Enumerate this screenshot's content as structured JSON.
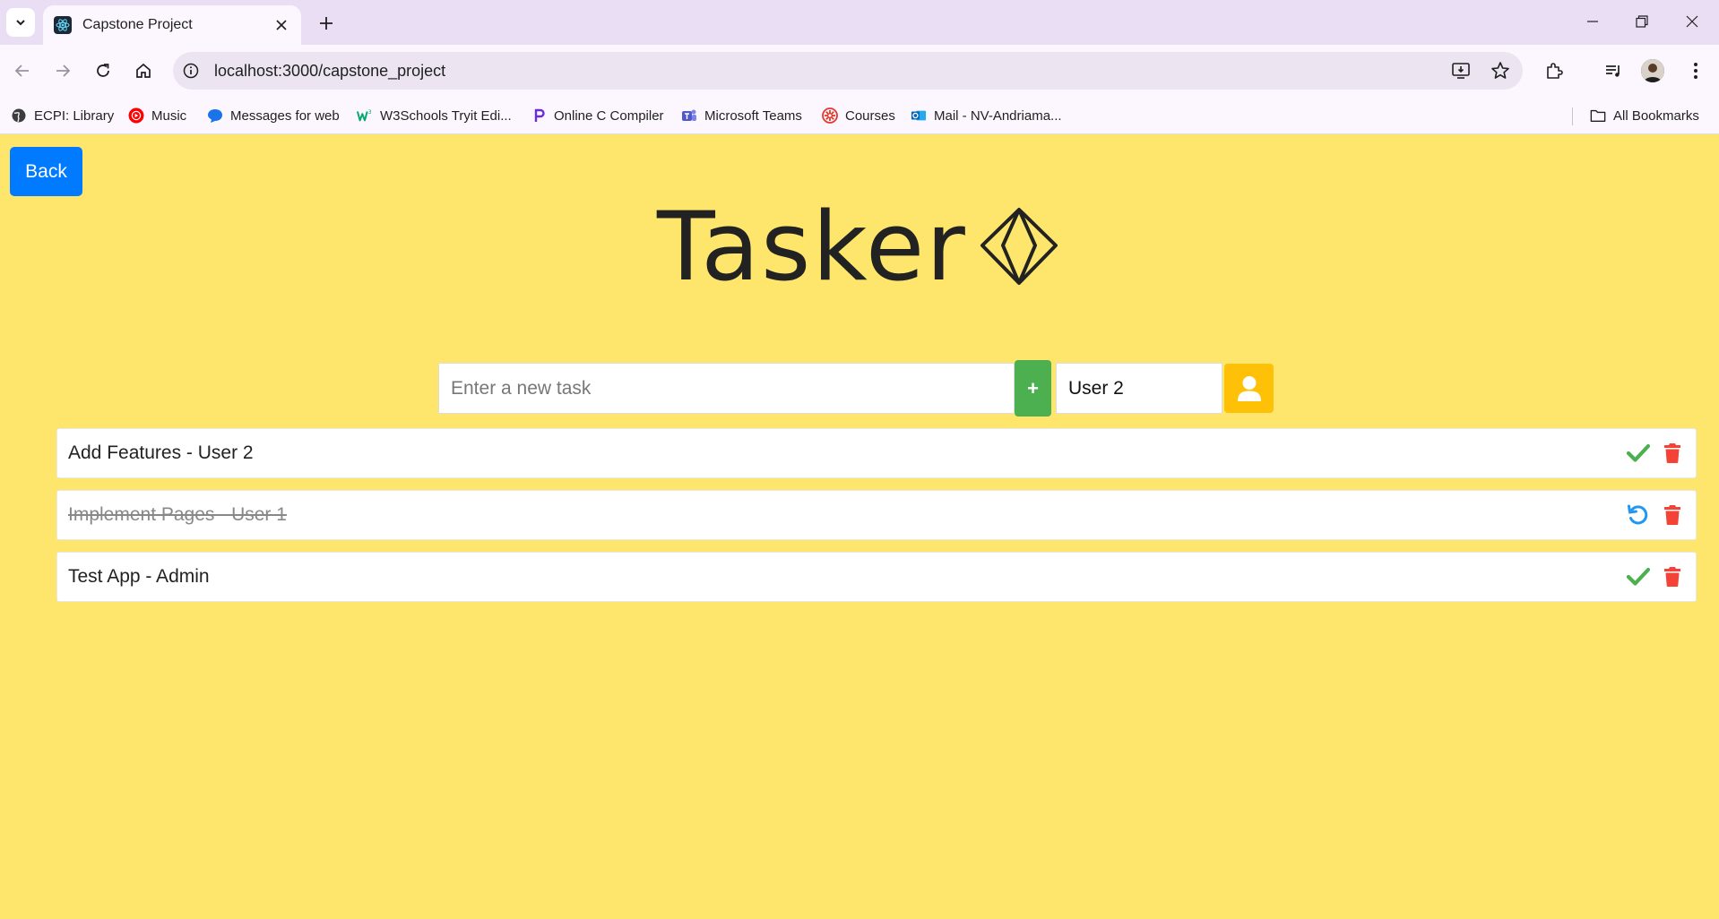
{
  "browser": {
    "tab_title": "Capstone Project",
    "url": "localhost:3000/capstone_project",
    "bookmarks": [
      {
        "label": "ECPI: Library",
        "icon": "globe-icon"
      },
      {
        "label": "Music",
        "icon": "youtube-music-icon"
      },
      {
        "label": "Messages for web",
        "icon": "messages-icon"
      },
      {
        "label": "W3Schools Tryit Edi...",
        "icon": "w3schools-icon"
      },
      {
        "label": "Online C Compiler",
        "icon": "compiler-icon"
      },
      {
        "label": "Microsoft Teams",
        "icon": "teams-icon"
      },
      {
        "label": "Courses",
        "icon": "courses-icon"
      },
      {
        "label": "Mail - NV-Andriama...",
        "icon": "outlook-icon"
      }
    ],
    "all_bookmarks": "All Bookmarks"
  },
  "app": {
    "back_label": "Back",
    "logo_text": "Tasker",
    "task_placeholder": "Enter a new task",
    "add_label": "+",
    "user_value": "User 2",
    "colors": {
      "background": "#fde66b",
      "back_button": "#007bff",
      "add_button": "#4caf50",
      "user_button": "#ffc107",
      "complete_icon": "#4caf50",
      "undo_icon": "#2196f3",
      "delete_icon": "#f44336"
    },
    "tasks": [
      {
        "text": "Add Features - User 2",
        "completed": false,
        "action_icon": "check-icon"
      },
      {
        "text": "Implement Pages - User 1",
        "completed": true,
        "action_icon": "undo-icon"
      },
      {
        "text": "Test App - Admin",
        "completed": false,
        "action_icon": "check-icon"
      }
    ]
  }
}
